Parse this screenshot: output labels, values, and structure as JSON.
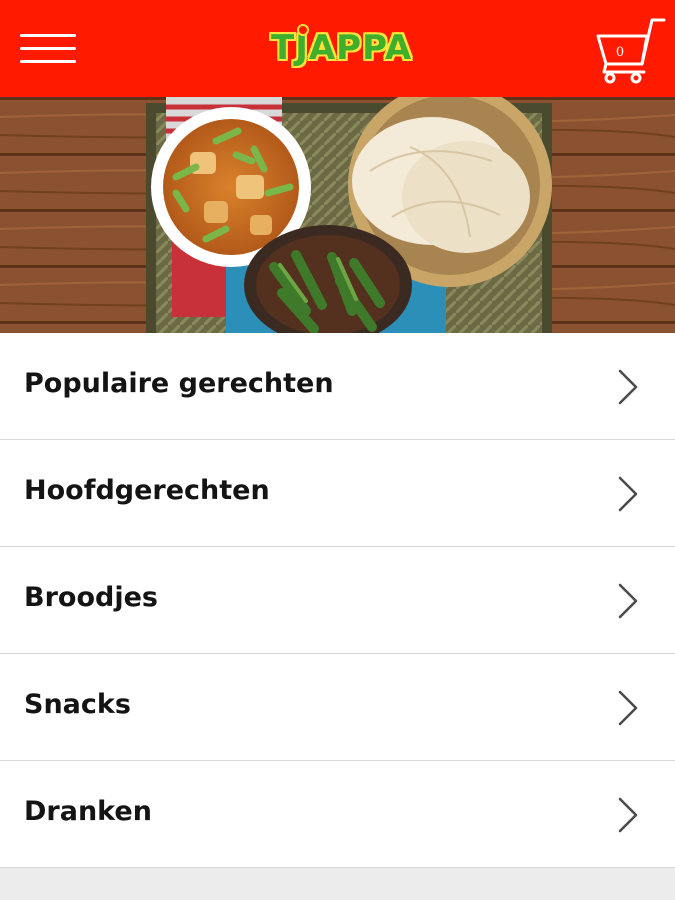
{
  "app": {
    "name": "TJAPPA"
  },
  "header": {
    "logo_text": "TJAPPA",
    "cart_count": "0",
    "menu_icon": "hamburger-menu-icon",
    "cart_icon": "shopping-cart-icon"
  },
  "hero": {
    "image": "indian-food-spread-photo"
  },
  "categories": [
    {
      "label": "Populaire gerechten"
    },
    {
      "label": "Hoofdgerechten"
    },
    {
      "label": "Broodjes"
    },
    {
      "label": "Snacks"
    },
    {
      "label": "Dranken"
    }
  ],
  "colors": {
    "brand_red": "#ff1a00",
    "logo_green": "#3fae2a",
    "logo_yellow": "#ffe33b",
    "text": "#141414",
    "divider": "#d8d8d8",
    "background": "#ececec"
  }
}
